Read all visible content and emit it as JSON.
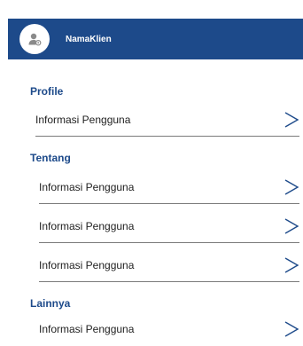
{
  "header": {
    "name": "NamaKlien",
    "bg_color": "#1d4a8a"
  },
  "sections": {
    "profile": {
      "title": "Profile",
      "items": [
        {
          "label": "Informasi Pengguna"
        }
      ]
    },
    "tentang": {
      "title": "Tentang",
      "items": [
        {
          "label": "Informasi Pengguna"
        },
        {
          "label": "Informasi Pengguna"
        },
        {
          "label": "Informasi Pengguna"
        }
      ]
    },
    "lainnya": {
      "title": "Lainnya",
      "items": [
        {
          "label": "Informasi Pengguna"
        }
      ]
    }
  },
  "icons": {
    "avatar": "user-settings-icon",
    "chevron": "chevron-right-icon"
  }
}
